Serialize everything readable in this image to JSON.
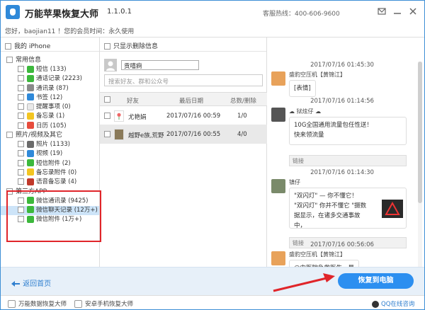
{
  "app": {
    "title": "万能苹果恢复大师",
    "version": "1.1.0.1",
    "hotline": "客服热线：400-606-9600",
    "greeting": "您好，baojian11 ！您的会员时间：永久使用"
  },
  "left_panel": {
    "header": "我的 iPhone",
    "categories": [
      {
        "label": "常用信息",
        "items": [
          {
            "label": "短信 (133)",
            "color": "#3cb83c"
          },
          {
            "label": "通话记录 (2223)",
            "color": "#3cb83c"
          },
          {
            "label": "通讯录 (87)",
            "color": "#8a8a8a"
          },
          {
            "label": "书签 (12)",
            "color": "#2f89d9"
          },
          {
            "label": "提醒事项 (0)",
            "color": "#e9e9e9"
          },
          {
            "label": "备忘录 (1)",
            "color": "#f3c521"
          },
          {
            "label": "日历 (105)",
            "color": "#e74c3c"
          }
        ]
      },
      {
        "label": "照片/视频及其它",
        "items": [
          {
            "label": "照片 (1133)",
            "color": "#6a6a6a"
          },
          {
            "label": "视频 (19)",
            "color": "#2f89d9"
          },
          {
            "label": "短信附件 (2)",
            "color": "#3cb83c"
          },
          {
            "label": "备忘录附件 (0)",
            "color": "#f3c521"
          },
          {
            "label": "语音备忘录 (4)",
            "color": "#c0392b"
          }
        ]
      },
      {
        "label": "第三方APP",
        "items": [
          {
            "label": "微信通讯录 (9425)",
            "color": "#3cb83c"
          },
          {
            "label": "微信聊天记录 (12万+)",
            "color": "#3cb83c",
            "selected": true
          },
          {
            "label": "微信附件 (1万+)",
            "color": "#3cb83c"
          }
        ]
      }
    ]
  },
  "middle_panel": {
    "filter_label": "只显示删除信息",
    "contact_name": "贡嘻痾",
    "search_placeholder": "搜索好友、群和公众号",
    "columns": [
      "好友",
      "最后日期",
      "总数/删除"
    ],
    "rows": [
      {
        "name": "尤艳娟",
        "date": "2017/07/16 00:59",
        "count": "1/0"
      },
      {
        "name": "越野e族,荒野",
        "date": "2017/07/16 00:55",
        "count": "4/0",
        "selected": true
      }
    ]
  },
  "chat": {
    "messages": [
      {
        "time": "2017/07/16 01:45:30",
        "sender": "盛豹空压机【黄锦江】",
        "text": "[表情]"
      },
      {
        "time": "2017/07/16 01:14:56",
        "sender": "☁ 狱炫仔 ☁",
        "text": "10G全国通用流量包任性送！",
        "text2": "快来领流量",
        "link": "链接"
      },
      {
        "time": "2017/07/16 01:14:30",
        "sender": "镇仔",
        "text": "\"双闪灯\" — 你不懂它！",
        "text2": "\"双闪灯\" 你并不懂它 \"摄数",
        "text3": "据显示，在诸多交通事故中，",
        "link": "链接"
      },
      {
        "time": "2017/07/16 00:56:06",
        "sender": "盛豹空压机【黄锦江】",
        "text": "@中医院急救医生，是"
      }
    ]
  },
  "bottom": {
    "back_label": "返回首页",
    "recover_label": "恢复到电脑"
  },
  "footer": {
    "item1": "万能数据恢复大师",
    "item2": "安卓手机恢复大师",
    "qq": "QQ在线咨询"
  },
  "colors": {
    "accent": "#2c8ff0",
    "highlight": "#e0252a"
  }
}
